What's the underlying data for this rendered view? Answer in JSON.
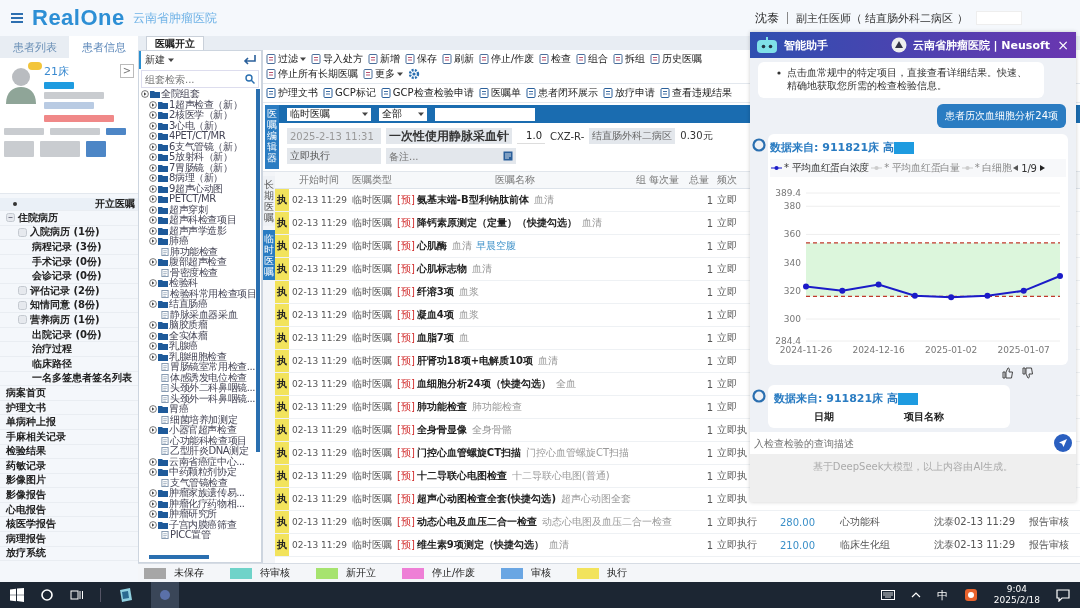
{
  "header": {
    "logo": "RealOne",
    "hospital": "云南省肿瘤医院",
    "user": "沈泰",
    "role": "副主任医师（ 结直肠外科二病区 ）"
  },
  "left_tabs": [
    {
      "label": "患者列表",
      "selected": false
    },
    {
      "label": "患者信息",
      "selected": true
    }
  ],
  "patient": {
    "bed": "21床",
    "expand": ">"
  },
  "nav": [
    {
      "label": "开立医嘱",
      "kind": "item",
      "selected": true
    },
    {
      "label": "住院病历",
      "kind": "group",
      "expanded": true,
      "selected": false,
      "children": [
        {
          "label": "入院病历 (1份)",
          "kind": "box",
          "selected": false
        },
        {
          "label": "病程记录 (3份)",
          "kind": "plain",
          "selected": false
        },
        {
          "label": "手术记录 (0份)",
          "kind": "plain",
          "selected": false
        },
        {
          "label": "会诊记录 (0份)",
          "kind": "plain",
          "selected": false
        },
        {
          "label": "评估记录 (2份)",
          "kind": "box",
          "selected": false
        },
        {
          "label": "知情同意 (8份)",
          "kind": "box",
          "selected": false
        },
        {
          "label": "营养病历 (1份)",
          "kind": "box",
          "selected": false
        },
        {
          "label": "出院记录 (0份)",
          "kind": "plain",
          "selected": false
        },
        {
          "label": "治疗过程",
          "kind": "plain",
          "selected": false
        },
        {
          "label": "临床路径",
          "kind": "plain",
          "selected": false
        },
        {
          "label": "一名多签患者签名列表",
          "kind": "plain",
          "selected": false
        }
      ]
    },
    {
      "label": "病案首页",
      "kind": "item",
      "selected": false
    },
    {
      "label": "护理文书",
      "kind": "item",
      "selected": false
    },
    {
      "label": "单病种上报",
      "kind": "item",
      "selected": false
    },
    {
      "label": "手麻相关记录",
      "kind": "item",
      "selected": false
    },
    {
      "label": "检验结果",
      "kind": "item",
      "selected": false
    },
    {
      "label": "药敏记录",
      "kind": "item",
      "selected": false
    },
    {
      "label": "影像图片",
      "kind": "item",
      "selected": false
    },
    {
      "label": "影像报告",
      "kind": "item",
      "selected": false
    },
    {
      "label": "心电报告",
      "kind": "item",
      "selected": false
    },
    {
      "label": "核医学报告",
      "kind": "item",
      "selected": false
    },
    {
      "label": "病理报告",
      "kind": "item",
      "selected": false
    },
    {
      "label": "放疗系统",
      "kind": "item",
      "selected": false
    }
  ],
  "workspace_tabs": [
    {
      "label": "医嘱开立",
      "selected": true
    }
  ],
  "tree_toolbar": {
    "new_button": "新建",
    "search_placeholder": "组套检索..."
  },
  "tree": [
    {
      "label": "全院组套",
      "kind": "folder",
      "children": [
        {
          "label": "1超声检查（新）",
          "kind": "folder"
        },
        {
          "label": "2核医学（新）",
          "kind": "folder"
        },
        {
          "label": "3心电（新）",
          "kind": "folder"
        },
        {
          "label": "4PET/CT/MR",
          "kind": "folder"
        },
        {
          "label": "6支气管镜（新）",
          "kind": "folder"
        },
        {
          "label": "5放射科（新）",
          "kind": "folder"
        },
        {
          "label": "7胃肠镜（新）",
          "kind": "folder"
        },
        {
          "label": "8病理（新）",
          "kind": "folder"
        },
        {
          "label": "9超声心动图",
          "kind": "folder"
        },
        {
          "label": "PETCT/MR",
          "kind": "folder"
        },
        {
          "label": "超声穿刺",
          "kind": "folder"
        },
        {
          "label": "超声科检查项目",
          "kind": "folder"
        },
        {
          "label": "超声声学造影",
          "kind": "folder"
        },
        {
          "label": "肺癌",
          "kind": "folder",
          "children": [
            {
              "label": "肺功能检查",
              "kind": "file"
            }
          ]
        },
        {
          "label": "腹部超声检查",
          "kind": "folder",
          "children": [
            {
              "label": "骨密度检查",
              "kind": "file"
            }
          ]
        },
        {
          "label": "检验科",
          "kind": "folder",
          "children": [
            {
              "label": "检验科常用检查项目",
              "kind": "file"
            }
          ]
        },
        {
          "label": "结直肠癌",
          "kind": "folder",
          "children": [
            {
              "label": "静脉采血器采血",
              "kind": "file"
            }
          ]
        },
        {
          "label": "脑胶质瘤",
          "kind": "folder"
        },
        {
          "label": "全实体瘤",
          "kind": "folder"
        },
        {
          "label": "乳腺癌",
          "kind": "folder"
        },
        {
          "label": "乳腺细胞检查",
          "kind": "folder",
          "children": [
            {
              "label": "胃肠镜室常用检查...",
              "kind": "file"
            },
            {
              "label": "体感诱发电位检查",
              "kind": "file"
            },
            {
              "label": "头颈外二科鼻咽镜...",
              "kind": "file"
            },
            {
              "label": "头颈外一科鼻咽镜...",
              "kind": "file"
            }
          ]
        },
        {
          "label": "胃癌",
          "kind": "folder",
          "children": [
            {
              "label": "细菌培养加测定",
              "kind": "file"
            }
          ]
        },
        {
          "label": "小器官超声检查",
          "kind": "folder",
          "children": [
            {
              "label": "心功能科检查项目",
              "kind": "file"
            },
            {
              "label": "乙型肝炎DNA测定",
              "kind": "file"
            }
          ]
        },
        {
          "label": "云南省癌症中心...",
          "kind": "folder"
        },
        {
          "label": "中药颗粒剂协定",
          "kind": "folder",
          "children": [
            {
              "label": "支气管镜检查",
              "kind": "file"
            }
          ]
        },
        {
          "label": "肿瘤家族遗传易...",
          "kind": "folder"
        },
        {
          "label": "肿瘤化疗药物相...",
          "kind": "folder"
        },
        {
          "label": "肿瘤研究所",
          "kind": "folder"
        },
        {
          "label": "子宫内膜癌筛查",
          "kind": "folder",
          "children": [
            {
              "label": "PICC置管",
              "kind": "file"
            }
          ]
        }
      ]
    }
  ],
  "toolbar": [
    {
      "label": "过滤",
      "dropdown": true
    },
    {
      "label": "导入处方",
      "dropdown": false
    },
    {
      "label": "新增",
      "dropdown": false
    },
    {
      "label": "保存",
      "dropdown": false
    },
    {
      "label": "刷新",
      "dropdown": false
    },
    {
      "label": "停止/作废",
      "dropdown": false
    },
    {
      "label": "检查",
      "dropdown": false
    },
    {
      "label": "组合",
      "dropdown": false
    },
    {
      "label": "拆组",
      "dropdown": false
    },
    {
      "label": "历史医嘱",
      "dropdown": false
    },
    {
      "label": "停止所有长期医嘱",
      "dropdown": false
    },
    {
      "label": "更多",
      "dropdown": true
    }
  ],
  "toolbar2": [
    {
      "label": "护理文书"
    },
    {
      "label": "GCP标记"
    },
    {
      "label": "GCP检查检验申请"
    },
    {
      "label": "医嘱单"
    },
    {
      "label": "患者闭环展示"
    },
    {
      "label": "放疗申请"
    },
    {
      "label": "查看违规结果"
    }
  ],
  "editor": {
    "label": "医嘱编辑器",
    "order_kind": "临时医嘱",
    "scope": "全部",
    "start": "2025-2-13 11:31",
    "item": "一次性使用静脉采血针",
    "dose": "1.0",
    "code": "CXZ-R-",
    "ward": "结直肠外科二病区",
    "price": "0.30元",
    "frequency": "立即执行",
    "note_placeholder": "备注..."
  },
  "order_tabs": [
    {
      "label": "长期医嘱",
      "selected": false
    },
    {
      "label": "临时医嘱",
      "selected": true
    }
  ],
  "table": {
    "columns": [
      "开始时间",
      "医嘱类型",
      "医嘱名称",
      "组",
      "每次量",
      "总量",
      "频次"
    ],
    "rows": [
      {
        "status": "执",
        "color": "#f2e35c",
        "start": "02-13 11:29",
        "type": "临时医嘱",
        "prefix": "[预]",
        "name": "氨基末端-B型利钠肽前体",
        "specimen": "血清",
        "total": "1",
        "frequency": "立即"
      },
      {
        "status": "执",
        "color": "#f2e35c",
        "start": "02-13 11:29",
        "type": "临时医嘱",
        "prefix": "[预]",
        "name": "降钙素原测定（定量）（快捷勾选）",
        "specimen": "血清",
        "total": "1",
        "frequency": "立即"
      },
      {
        "status": "执",
        "color": "#f2e35c",
        "start": "02-13 11:29",
        "type": "临时医嘱",
        "prefix": "[预]",
        "name": "心肌酶",
        "specimen": "血清",
        "note": "早晨空腹",
        "total": "1",
        "frequency": "立即"
      },
      {
        "status": "执",
        "color": "#f2e35c",
        "start": "02-13 11:29",
        "type": "临时医嘱",
        "prefix": "[预]",
        "name": "心肌标志物",
        "specimen": "血清",
        "total": "1",
        "frequency": "立即"
      },
      {
        "status": "执",
        "color": "#f2e35c",
        "start": "02-13 11:29",
        "type": "临时医嘱",
        "prefix": "[预]",
        "name": "纤溶3项",
        "specimen": "血浆",
        "total": "1",
        "frequency": "立即"
      },
      {
        "status": "执",
        "color": "#f2e35c",
        "start": "02-13 11:29",
        "type": "临时医嘱",
        "prefix": "[预]",
        "name": "凝血4项",
        "specimen": "血浆",
        "total": "1",
        "frequency": "立即"
      },
      {
        "status": "执",
        "color": "#f2e35c",
        "start": "02-13 11:29",
        "type": "临时医嘱",
        "prefix": "[预]",
        "name": "血脂7项",
        "specimen": "血",
        "total": "1",
        "frequency": "立即"
      },
      {
        "status": "执",
        "color": "#f2e35c",
        "start": "02-13 11:29",
        "type": "临时医嘱",
        "prefix": "[预]",
        "name": "肝肾功18项+电解质10项",
        "specimen": "血清",
        "total": "1",
        "frequency": "立即"
      },
      {
        "status": "执",
        "color": "#f2e35c",
        "start": "02-13 11:29",
        "type": "临时医嘱",
        "prefix": "[预]",
        "name": "血细胞分析24项（快捷勾选）",
        "specimen": "全血",
        "total": "1",
        "frequency": "立即"
      },
      {
        "status": "执",
        "color": "#f2e35c",
        "start": "02-13 11:29",
        "type": "临时医嘱",
        "prefix": "[预]",
        "name": "肺功能检查",
        "specimen": "肺功能检查",
        "total": "1",
        "frequency": "立即"
      },
      {
        "status": "执",
        "color": "#f2e35c",
        "start": "02-13 11:29",
        "type": "临时医嘱",
        "prefix": "[预]",
        "name": "全身骨显像",
        "specimen": "全身骨骼",
        "total": "1",
        "frequency": "立即执"
      },
      {
        "status": "执",
        "color": "#f2e35c",
        "start": "02-13 11:29",
        "type": "临时医嘱",
        "prefix": "[预]",
        "name": "门控心血管螺旋CT扫描",
        "specimen": "门控心血管螺旋CT扫描",
        "total": "1",
        "frequency": "立即执"
      },
      {
        "status": "执",
        "color": "#f2e35c",
        "start": "02-13 11:29",
        "type": "临时医嘱",
        "prefix": "[预]",
        "name": "十二导联心电图检查",
        "specimen": "十二导联心电图(普通)",
        "total": "1",
        "frequency": "立即执"
      },
      {
        "status": "执",
        "color": "#f2e35c",
        "start": "02-13 11:29",
        "type": "临时医嘱",
        "prefix": "[预]",
        "name": "超声心动图检查全套(快捷勾选)",
        "specimen": "超声心动图全套",
        "total": "1",
        "frequency": "立即执"
      },
      {
        "status": "执",
        "color": "#f2e35c",
        "start": "02-13 11:29",
        "type": "临时医嘱",
        "prefix": "[预]",
        "name": "动态心电及血压二合一检查",
        "specimen": "动态心电图及血压二合一检查",
        "total": "1",
        "frequency": "立即执行",
        "price": "280.00",
        "dept": "心功能科",
        "doctor": "沈泰02-13 11:29",
        "state": "报告审核"
      },
      {
        "status": "执",
        "color": "#f2e35c",
        "start": "02-13 11:29",
        "type": "临时医嘱",
        "prefix": "[预]",
        "name": "维生素9项测定（快捷勾选）",
        "specimen": "血清",
        "total": "1",
        "frequency": "立即执行",
        "price": "210.00",
        "dept": "临床生化组",
        "doctor": "沈泰02-13 11:29",
        "state": "报告审核"
      }
    ]
  },
  "legend": [
    {
      "label": "未保存",
      "color": "#a6a6a6"
    },
    {
      "label": "待审核",
      "color": "#6fd3c9"
    },
    {
      "label": "新开立",
      "color": "#a6e36f"
    },
    {
      "label": "停止/作废",
      "color": "#ee7fd6"
    },
    {
      "label": "审核",
      "color": "#6aa6e3"
    },
    {
      "label": "执行",
      "color": "#f2e35c"
    }
  ],
  "assistant": {
    "title": "智能助手",
    "brand": "云南省肿瘤医院 | Neusoft",
    "close": "×",
    "intro": "点击血常规中的特定项目，直接查看详细结果。快速、精确地获取您所需的检查检验信息。",
    "user_message": "患者历次血细胞分析24项",
    "chart_card": {
      "source": "数据来自: 911821床 高",
      "legend": [
        {
          "label": "* 平均血红蛋白浓度",
          "selected": true
        },
        {
          "label": "* 平均血红蛋白量",
          "selected": false
        },
        {
          "label": "* 白细胞",
          "selected": false
        }
      ],
      "page": "1/9",
      "chart_data": {
        "type": "line",
        "categories": [
          "2024-11-26",
          null,
          "2024-12-16",
          null,
          "2025-01-02",
          null,
          "2025-01-07",
          null
        ],
        "grid": true,
        "series": [
          {
            "color": "#1b1bc8",
            "marker": true,
            "values": [
              323,
              320,
              324.5,
              316.5,
              315.5,
              316.5,
              320,
              330.5
            ]
          }
        ],
        "ylim": [
          284.4,
          389.4
        ],
        "yticks": [
          284.4,
          300,
          320,
          340,
          360,
          380,
          389.4
        ],
        "ref_lines": [
          {
            "axis": "y",
            "value": 354
          },
          {
            "axis": "y",
            "value": 316
          }
        ],
        "bands": [
          {
            "axis": "y",
            "from": 316,
            "to": 354
          }
        ]
      }
    },
    "table_card": {
      "source": "数据来自: 911821床 高",
      "columns": [
        "日期",
        "项目名称"
      ]
    },
    "input_placeholder": "入检查检验的查询描述",
    "disclaimer": "基于DeepSeek大模型，以上内容由AI生成。"
  },
  "taskbar": {
    "ime": "中",
    "time": "9:04",
    "date": "2025/2/18"
  }
}
